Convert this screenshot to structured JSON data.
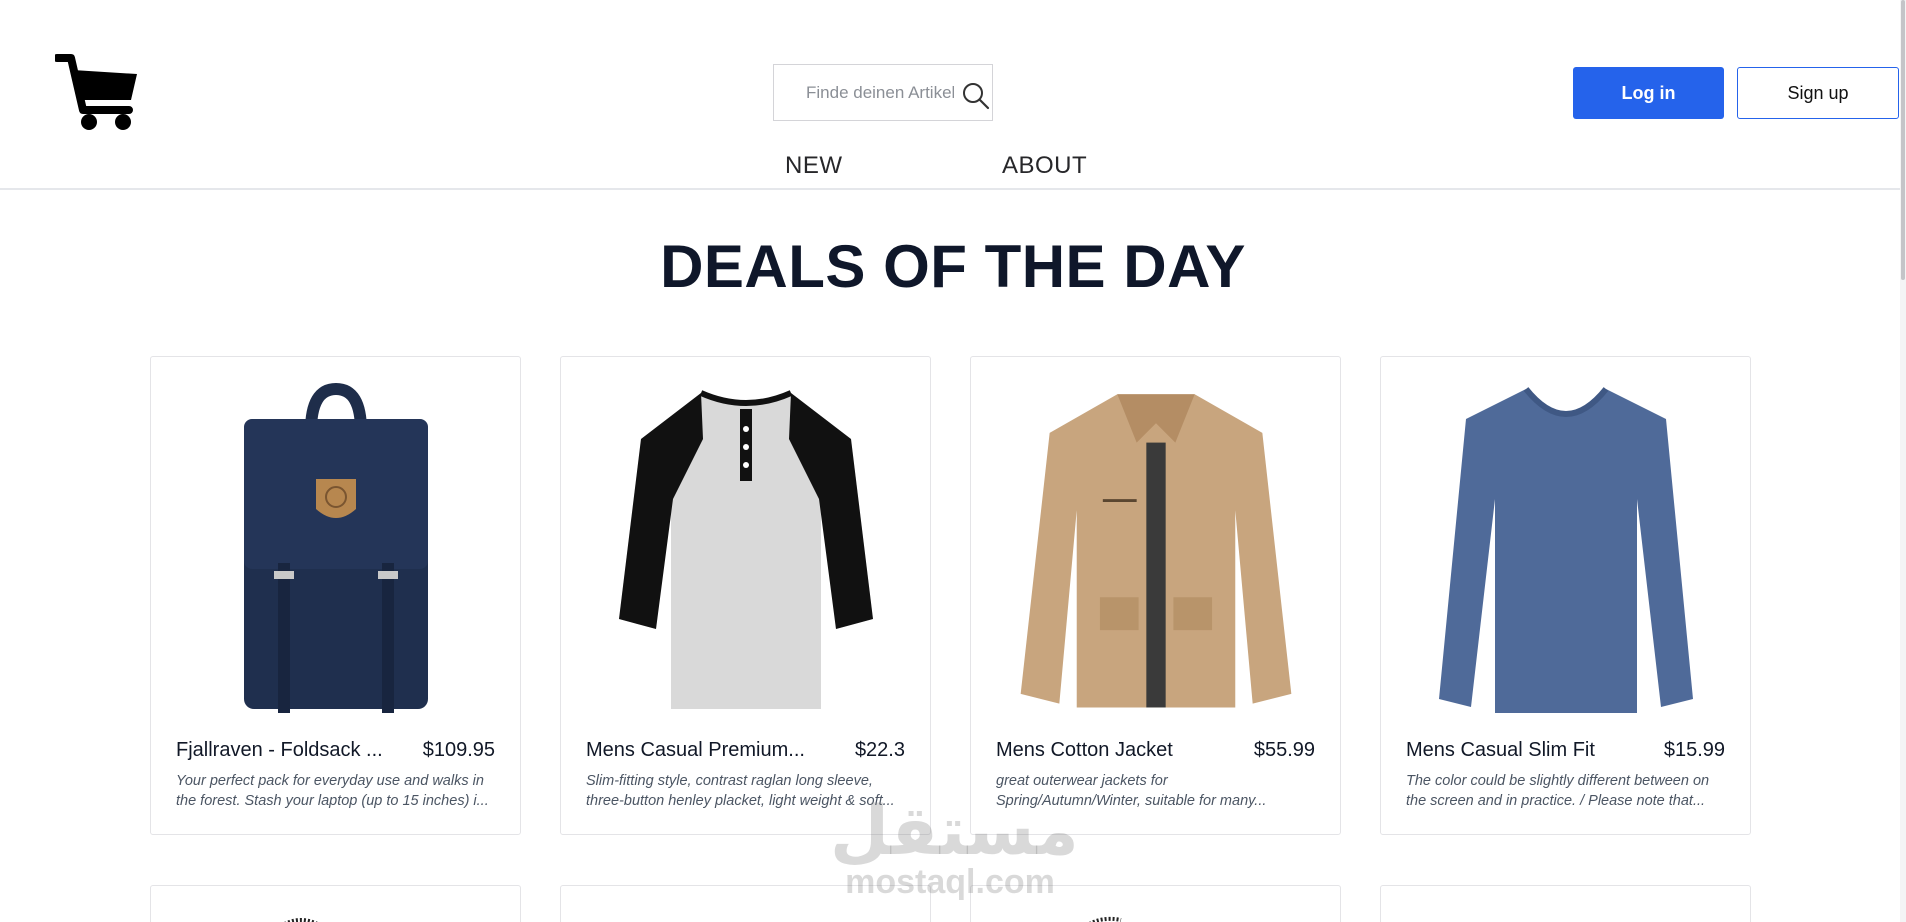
{
  "header": {
    "logo_icon": "shopping-cart-icon",
    "search": {
      "placeholder": "Finde deinen Artikel",
      "icon": "search-icon"
    },
    "login_label": "Log in",
    "signup_label": "Sign up",
    "accent_color": "#2563eb"
  },
  "nav": {
    "items": [
      {
        "label": "NEW"
      },
      {
        "label": "ABOUT"
      }
    ]
  },
  "main": {
    "title": "DEALS OF THE DAY",
    "products": [
      {
        "name": "Fjallraven - Foldsack ...",
        "price": "$109.95",
        "description": "Your perfect pack for everyday use and walks in the forest. Stash your laptop (up to 15 inches) i...",
        "image": "backpack"
      },
      {
        "name": "Mens Casual Premium...",
        "price": "$22.3",
        "description": "Slim-fitting style, contrast raglan long sleeve, three-button henley placket, light weight & soft...",
        "image": "raglan-tshirt"
      },
      {
        "name": "Mens Cotton Jacket",
        "price": "$55.99",
        "description": "great outerwear jackets for Spring/Autumn/Winter, suitable for many...",
        "image": "cotton-jacket"
      },
      {
        "name": "Mens Casual Slim Fit",
        "price": "$15.99",
        "description": "The color could be slightly different between on the screen and in practice. / Please note that...",
        "image": "long-sleeve-shirt"
      }
    ]
  },
  "watermark": {
    "arabic": "مستقل",
    "latin": "mostaql.com"
  }
}
